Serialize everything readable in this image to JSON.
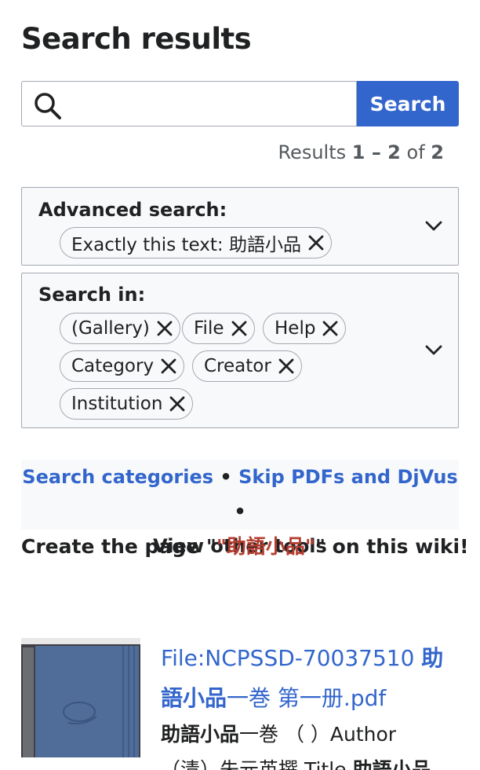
{
  "header": {
    "title": "Search results"
  },
  "search": {
    "value": "",
    "placeholder": "",
    "button_label": "Search"
  },
  "results_count": {
    "prefix": "Results",
    "range": "1 – 2",
    "of_word": "of",
    "total": "2"
  },
  "advanced_search": {
    "label": "Advanced search:",
    "chips": [
      {
        "label": "Exactly this text: 助語小品"
      }
    ]
  },
  "search_in": {
    "label": "Search in:",
    "chips": [
      {
        "label": "(Gallery)"
      },
      {
        "label": "File"
      },
      {
        "label": "Help"
      },
      {
        "label": "Category"
      },
      {
        "label": "Creator"
      },
      {
        "label": "Institution"
      }
    ]
  },
  "tools": {
    "search_categories": "Search categories",
    "separator": "•",
    "skip_pdfs": "Skip PDFs and DjVus",
    "view_other_tools": "View other tools"
  },
  "create_page": {
    "prefix": "Create the page \"",
    "link": "\"助語小品\"",
    "suffix": "\" on this wiki!"
  },
  "results": [
    {
      "title_part1": "File:NCPSSD-70037510 ",
      "title_bold1": "助語小品",
      "title_part2": "一巻 第一册.pdf",
      "snippet_bold1": "助語小品",
      "snippet_part1": "一巻 （ ）Author",
      "snippet_part2": "（清）朱元英撰 Title ",
      "snippet_bold2": "助語小品"
    }
  ],
  "colors": {
    "accent": "#3366cc",
    "redlink": "#b43d2f",
    "text": "#202122",
    "muted": "#54595d"
  }
}
